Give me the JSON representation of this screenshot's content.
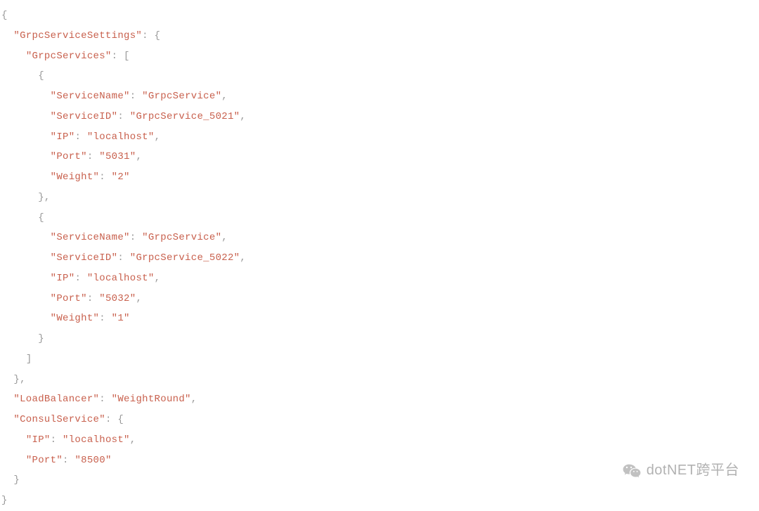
{
  "code": {
    "lines": [
      {
        "indent": 0,
        "tokens": [
          {
            "t": "p",
            "v": "{"
          }
        ]
      },
      {
        "indent": 1,
        "tokens": [
          {
            "t": "k",
            "v": "\"GrpcServiceSettings\""
          },
          {
            "t": "p",
            "v": ": {"
          }
        ]
      },
      {
        "indent": 2,
        "tokens": [
          {
            "t": "k",
            "v": "\"GrpcServices\""
          },
          {
            "t": "p",
            "v": ": ["
          }
        ]
      },
      {
        "indent": 3,
        "tokens": [
          {
            "t": "p",
            "v": "{"
          }
        ]
      },
      {
        "indent": 4,
        "tokens": [
          {
            "t": "k",
            "v": "\"ServiceName\""
          },
          {
            "t": "p",
            "v": ": "
          },
          {
            "t": "k",
            "v": "\"GrpcService\""
          },
          {
            "t": "p",
            "v": ","
          }
        ]
      },
      {
        "indent": 4,
        "tokens": [
          {
            "t": "k",
            "v": "\"ServiceID\""
          },
          {
            "t": "p",
            "v": ": "
          },
          {
            "t": "k",
            "v": "\"GrpcService_5021\""
          },
          {
            "t": "p",
            "v": ","
          }
        ]
      },
      {
        "indent": 4,
        "tokens": [
          {
            "t": "k",
            "v": "\"IP\""
          },
          {
            "t": "p",
            "v": ": "
          },
          {
            "t": "k",
            "v": "\"localhost\""
          },
          {
            "t": "p",
            "v": ","
          }
        ]
      },
      {
        "indent": 4,
        "tokens": [
          {
            "t": "k",
            "v": "\"Port\""
          },
          {
            "t": "p",
            "v": ": "
          },
          {
            "t": "k",
            "v": "\"5031\""
          },
          {
            "t": "p",
            "v": ","
          }
        ]
      },
      {
        "indent": 4,
        "tokens": [
          {
            "t": "k",
            "v": "\"Weight\""
          },
          {
            "t": "p",
            "v": ": "
          },
          {
            "t": "k",
            "v": "\"2\""
          }
        ]
      },
      {
        "indent": 3,
        "tokens": [
          {
            "t": "p",
            "v": "},"
          }
        ]
      },
      {
        "indent": 3,
        "tokens": [
          {
            "t": "p",
            "v": "{"
          }
        ]
      },
      {
        "indent": 4,
        "tokens": [
          {
            "t": "k",
            "v": "\"ServiceName\""
          },
          {
            "t": "p",
            "v": ": "
          },
          {
            "t": "k",
            "v": "\"GrpcService\""
          },
          {
            "t": "p",
            "v": ","
          }
        ]
      },
      {
        "indent": 4,
        "tokens": [
          {
            "t": "k",
            "v": "\"ServiceID\""
          },
          {
            "t": "p",
            "v": ": "
          },
          {
            "t": "k",
            "v": "\"GrpcService_5022\""
          },
          {
            "t": "p",
            "v": ","
          }
        ]
      },
      {
        "indent": 4,
        "tokens": [
          {
            "t": "k",
            "v": "\"IP\""
          },
          {
            "t": "p",
            "v": ": "
          },
          {
            "t": "k",
            "v": "\"localhost\""
          },
          {
            "t": "p",
            "v": ","
          }
        ]
      },
      {
        "indent": 4,
        "tokens": [
          {
            "t": "k",
            "v": "\"Port\""
          },
          {
            "t": "p",
            "v": ": "
          },
          {
            "t": "k",
            "v": "\"5032\""
          },
          {
            "t": "p",
            "v": ","
          }
        ]
      },
      {
        "indent": 4,
        "tokens": [
          {
            "t": "k",
            "v": "\"Weight\""
          },
          {
            "t": "p",
            "v": ": "
          },
          {
            "t": "k",
            "v": "\"1\""
          }
        ]
      },
      {
        "indent": 3,
        "tokens": [
          {
            "t": "p",
            "v": "}"
          }
        ]
      },
      {
        "indent": 2,
        "tokens": [
          {
            "t": "p",
            "v": "]"
          }
        ]
      },
      {
        "indent": 1,
        "tokens": [
          {
            "t": "p",
            "v": "},"
          }
        ]
      },
      {
        "indent": 1,
        "tokens": [
          {
            "t": "k",
            "v": "\"LoadBalancer\""
          },
          {
            "t": "p",
            "v": ": "
          },
          {
            "t": "k",
            "v": "\"WeightRound\""
          },
          {
            "t": "p",
            "v": ","
          }
        ]
      },
      {
        "indent": 1,
        "tokens": [
          {
            "t": "k",
            "v": "\"ConsulService\""
          },
          {
            "t": "p",
            "v": ": {"
          }
        ]
      },
      {
        "indent": 2,
        "tokens": [
          {
            "t": "k",
            "v": "\"IP\""
          },
          {
            "t": "p",
            "v": ": "
          },
          {
            "t": "k",
            "v": "\"localhost\""
          },
          {
            "t": "p",
            "v": ","
          }
        ]
      },
      {
        "indent": 2,
        "tokens": [
          {
            "t": "k",
            "v": "\"Port\""
          },
          {
            "t": "p",
            "v": ": "
          },
          {
            "t": "k",
            "v": "\"8500\""
          }
        ]
      },
      {
        "indent": 1,
        "tokens": [
          {
            "t": "p",
            "v": "}"
          }
        ]
      },
      {
        "indent": 0,
        "tokens": [
          {
            "t": "p",
            "v": "}"
          }
        ]
      }
    ]
  },
  "watermark": {
    "text": "dotNET跨平台"
  },
  "indent_units": [
    "",
    "  ",
    "    ",
    "      ",
    "        "
  ]
}
